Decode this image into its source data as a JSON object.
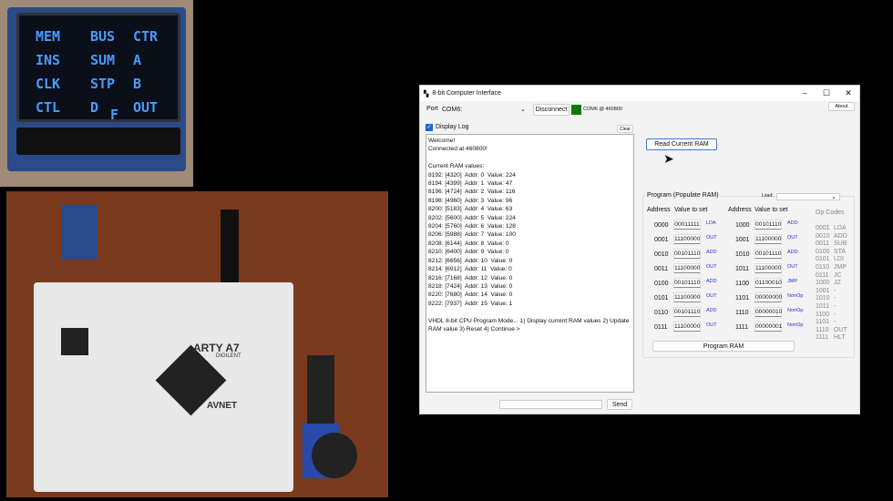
{
  "oled_photo": {
    "rows": [
      [
        "MEM",
        "BUS",
        "CTR"
      ],
      [
        "INS",
        "SUM",
        "A"
      ],
      [
        "CLK",
        "STP",
        "B"
      ],
      [
        "CTL",
        "D",
        "OUT"
      ]
    ],
    "extra": "F"
  },
  "board_photo": {
    "brand": "ARTY A7",
    "vendor": "AVNET",
    "maker": "DIGILENT"
  },
  "window": {
    "title": "8-bit Computer Interface",
    "controls": [
      "–",
      "☐",
      "✕"
    ]
  },
  "port": {
    "label": "Port",
    "value": "COM6:",
    "disconnect": "Disconnect",
    "status_color": "#0a7a0a",
    "status": "COM6 @ 460800",
    "about": "About"
  },
  "log": {
    "display_label": "Display Log",
    "checked": true,
    "clear": "Clear",
    "text": "Welcome!\nConnected at 460800!\n\nCurrent RAM values:\n8192: [4320]  Addr: 0  Value: 224\n8194: [4399]  Addr: 1  Value: 47\n8196: [4724]  Addr: 2  Value: 116\n8198: [4960]  Addr: 3  Value: 96\n8200: [5183]  Addr: 4  Value: 63\n8202: [5600]  Addr: 5  Value: 224\n8204: [5760]  Addr: 6  Value: 128\n8206: [5988]  Addr: 7  Value: 100\n8208: [6144]  Addr: 8  Value: 0\n8210: [6400]  Addr: 9  Value: 0\n8212: [6656]  Addr: 10  Value: 0\n8214: [6912]  Addr: 11  Value: 0\n8216: [7168]  Addr: 12  Value: 0\n8218: [7424]  Addr: 13  Value: 0\n8220: [7680]  Addr: 14  Value: 0\n8222: [7937]  Addr: 15  Value: 1\n\nVHDL 8-bit CPU Program Mode... 1) Display current RAM values 2) Update RAM value 3) Reset 4) Continue >",
    "send_value": "",
    "send": "Send"
  },
  "read_ram": "Read Current RAM",
  "program": {
    "title": "Program (Populate RAM)",
    "load_label": "Load:",
    "load_value": "",
    "address_header": "Address",
    "value_header": "Value to set",
    "program_button": "Program RAM",
    "left": [
      [
        "0000",
        "00011111",
        "LDA"
      ],
      [
        "0001",
        "11100000",
        "OUT"
      ],
      [
        "0010",
        "00101110",
        "ADD"
      ],
      [
        "0011",
        "11100000",
        "OUT"
      ],
      [
        "0100",
        "00101110",
        "ADD"
      ],
      [
        "0101",
        "11100000",
        "OUT"
      ],
      [
        "0110",
        "00101110",
        "ADD"
      ],
      [
        "0111",
        "11100000",
        "OUT"
      ]
    ],
    "right": [
      [
        "1000",
        "00101110",
        "ADD"
      ],
      [
        "1001",
        "11100000",
        "OUT"
      ],
      [
        "1010",
        "00101110",
        "ADD"
      ],
      [
        "1011",
        "11100000",
        "OUT"
      ],
      [
        "1100",
        "01100010",
        "JMP"
      ],
      [
        "1101",
        "00000000",
        "NonOp"
      ],
      [
        "1110",
        "00000010",
        "NonOp"
      ],
      [
        "1111",
        "00000001",
        "NonOp"
      ]
    ],
    "opcodes_title": "Op Codes",
    "opcodes": [
      [
        "0001",
        "LDA"
      ],
      [
        "0010",
        "ADD"
      ],
      [
        "0011",
        "SUB"
      ],
      [
        "0100",
        "STA"
      ],
      [
        "0101",
        "LDI"
      ],
      [
        "0110",
        "JMP"
      ],
      [
        "0111",
        "JC"
      ],
      [
        "1000",
        "JZ"
      ],
      [
        "1001",
        "-"
      ],
      [
        "1010",
        "-"
      ],
      [
        "1011",
        "-"
      ],
      [
        "1100",
        "-"
      ],
      [
        "1101",
        "-"
      ],
      [
        "1110",
        "OUT"
      ],
      [
        "1111",
        "HLT"
      ]
    ]
  }
}
